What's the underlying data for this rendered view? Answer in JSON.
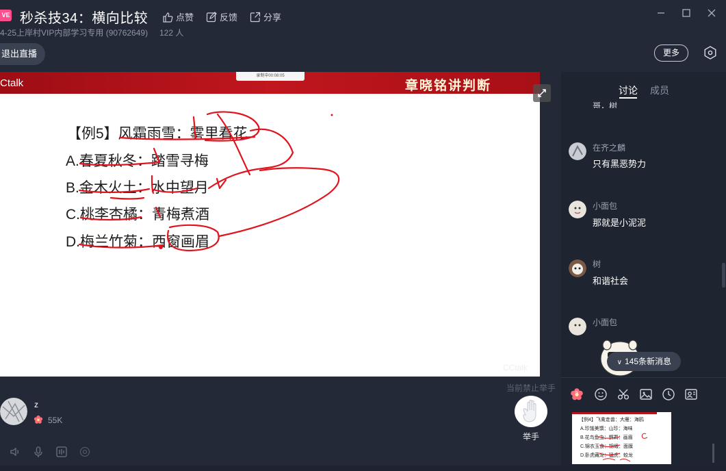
{
  "header": {
    "live_badge": "VE",
    "title": "秒杀技34：横向比较",
    "like_label": "点赞",
    "feedback_label": "反馈",
    "share_label": "分享",
    "subtitle": "4-25上岸村VIP内部学习专用 (90762649)",
    "viewers": "122 人",
    "exit_label": "退出直播",
    "more_label": "更多"
  },
  "slide": {
    "brand": "Ctalk",
    "recorder": "录制中00:08:05",
    "teacher_title": "章晓铭讲判断",
    "question": "【例5】风霜雨雪：雾里看花",
    "options": [
      "A.春夏秋冬：踏雪寻梅",
      "B.金木火土：水中望月",
      "C.桃李杏橘：青梅煮酒",
      "D.梅兰竹菊：西窗画眉"
    ],
    "watermark": "CCtalk"
  },
  "lower_bar": {
    "username": "z",
    "flowers": "55K",
    "ban_hand_notice": "当前禁止举手",
    "hand_label": "举手"
  },
  "panel": {
    "tabs": [
      "讨论",
      "成员"
    ],
    "cut_message": "哥，树",
    "messages": [
      {
        "name": "在齐之麟",
        "text": "只有黑恶势力"
      },
      {
        "name": "小面包",
        "text": "那就是小泥泥"
      },
      {
        "name": "树",
        "text": "和谐社会"
      },
      {
        "name": "小面包",
        "text": ""
      }
    ],
    "new_messages": "145条新消息",
    "flower_badge": "3",
    "thumbnail": {
      "question": "【例4】飞禽走兽：大雁：海鸥",
      "options": [
        "A.珍馐美馔：山珍：海味",
        "B.花鸟鱼虫：鹦鹉：画眉",
        "C.锦衣玉食：锦缎：面膜",
        "D.卧虎藏龙：猛虎：蛟龙"
      ]
    }
  },
  "colors": {
    "accent": "#ff4d8d",
    "slide_header": "#b3131b",
    "ink": "#e0141e"
  }
}
